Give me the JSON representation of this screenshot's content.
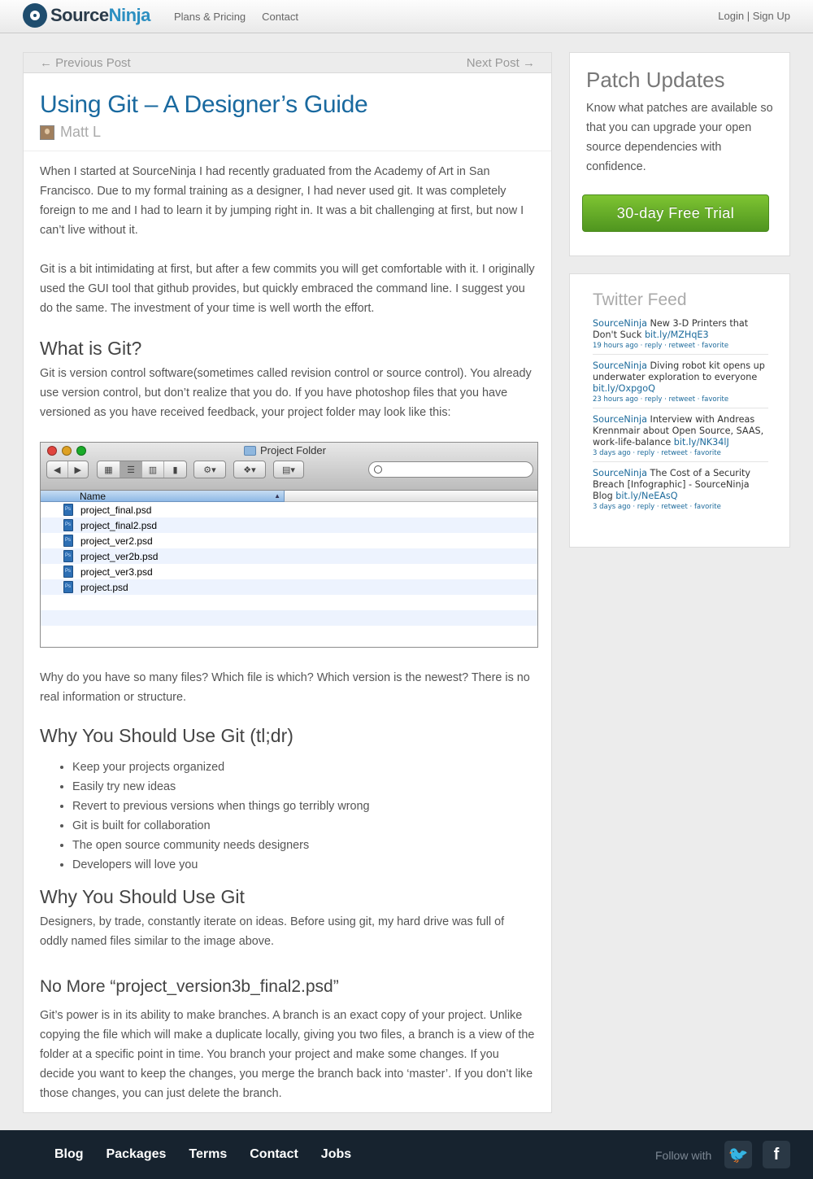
{
  "header": {
    "brand_part1": "Source",
    "brand_part2": "Ninja",
    "nav": [
      "Plans & Pricing",
      "Contact"
    ],
    "login": "Login",
    "separator": "|",
    "signup": "Sign Up"
  },
  "post_nav": {
    "previous": "← Previous Post",
    "next": "Next Post →"
  },
  "post": {
    "title": "Using Git – A Designer’s Guide",
    "author": "Matt L",
    "intro_p1": "When I started at SourceNinja I had recently graduated from the Academy of Art in San Francisco. Due to my formal training as a designer, I had never used git. It was completely foreign to me and I had to learn it by jumping right in. It was a bit challenging at first, but now I can’t live without it.",
    "intro_p2": "Git is a bit intimidating at first, but after a few commits you will get comfortable with it. I originally used the GUI tool that github provides, but quickly embraced the command line. I suggest you do the same. The investment of your time is well worth the effort.",
    "h_what": "What is Git?",
    "what_p": "Git is version control software(sometimes called revision control or source control). You already use version control, but don’t realize that you do. If you have photoshop files that you have versioned as you have received feedback, your project folder may look like this:",
    "after_image_p": "Why do you have so many files? Which file is which? Which version is the newest? There is no real information or structure.",
    "h_tldr": "Why You Should Use Git (tl;dr)",
    "tldr_items": [
      "Keep your projects organized",
      "Easily try new ideas",
      "Revert to previous versions when things go terribly wrong",
      "Git is built for collaboration",
      "The open source community needs designers",
      "Developers will love you"
    ],
    "h_why": "Why You Should Use Git",
    "why_p": "Designers, by trade, constantly iterate on ideas. Before using git, my hard drive was full of oddly named files similar to the image above.",
    "h_nomore": "No More “project_version3b_final2.psd”",
    "nomore_p": "Git’s power is in its ability to make branches. A branch is an exact copy of your project. Unlike copying the file which will make a duplicate locally, giving you two files, a branch is a view of the folder at a specific point in time. You branch your project and make some changes. If you decide you want to keep the changes, you merge the branch back into ‘master’. If you don’t like those changes, you can just delete the branch."
  },
  "finder": {
    "window_title": "Project Folder",
    "column_name": "Name",
    "files": [
      "project_final.psd",
      "project_final2.psd",
      "project_ver2.psd",
      "project_ver2b.psd",
      "project_ver3.psd",
      "project.psd"
    ],
    "light_colors": [
      "#e0443e",
      "#dea123",
      "#1aab29"
    ]
  },
  "patch_updates": {
    "title": "Patch Updates",
    "text": "Know what patches are available so that you can upgrade your open source dependencies with confidence.",
    "cta": "30-day Free Trial"
  },
  "twitter": {
    "title": "Twitter Feed",
    "tweets": [
      {
        "user": "SourceNinja",
        "text": "New 3-D Printers that Don't Suck",
        "link": "bit.ly/MZHqE3",
        "time": "19 hours ago",
        "actions": "· reply · retweet · favorite"
      },
      {
        "user": "SourceNinja",
        "text": "Diving robot kit opens up underwater exploration to everyone",
        "link": "bit.ly/OxpgoQ",
        "time": "23 hours ago",
        "actions": "· reply · retweet · favorite"
      },
      {
        "user": "SourceNinja",
        "text": "Interview with Andreas Krennmair about Open Source, SAAS, work-life-balance",
        "link": "bit.ly/NK34lJ",
        "time": "3 days ago",
        "actions": "· reply · retweet · favorite"
      },
      {
        "user": "SourceNinja",
        "text": "The Cost of a Security Breach [Infographic] - SourceNinja Blog",
        "link": "bit.ly/NeEAsQ",
        "time": "3 days ago",
        "actions": "· reply · retweet · favorite"
      }
    ]
  },
  "footer": {
    "links": [
      "Blog",
      "Packages",
      "Terms",
      "Contact",
      "Jobs"
    ],
    "follow": "Follow with",
    "twitter_glyph": "🐦",
    "facebook_glyph": "f"
  },
  "colors": {
    "accent_blue": "#19699f",
    "cta_green": "#6db22a",
    "footer_bg": "#17232f"
  }
}
